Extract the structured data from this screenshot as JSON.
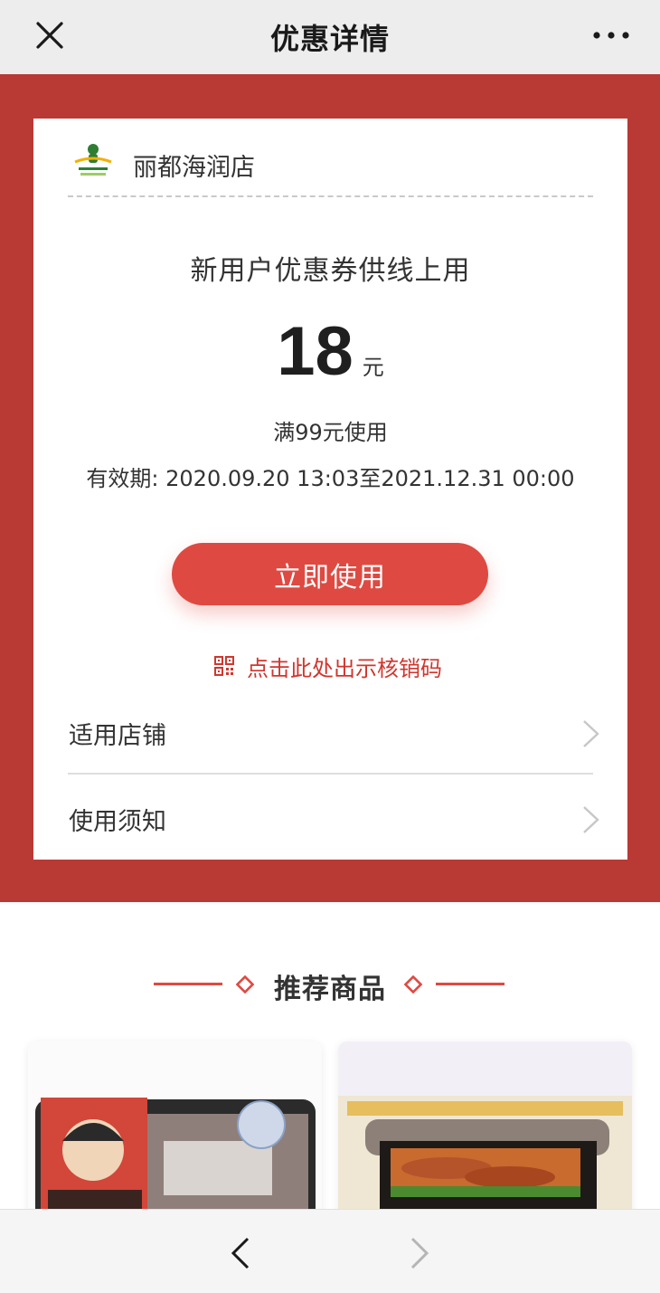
{
  "topbar": {
    "title": "优惠详情",
    "close_icon": "close-icon",
    "more_icon": "more-dots-icon"
  },
  "coupon": {
    "store_name": "丽都海润店",
    "name": "新用户优惠券供线上用",
    "amount": "18",
    "unit": "元",
    "condition": "满99元使用",
    "validity": "有效期: 2020.09.20 13:03至2021.12.31 00:00",
    "use_button": "立即使用",
    "qr_link": "点击此处出示核销码"
  },
  "menu": [
    {
      "label": "适用店铺"
    },
    {
      "label": "使用须知"
    }
  ],
  "recommend": {
    "title": "推荐商品"
  },
  "colors": {
    "accent": "#de4a42",
    "banner": "#b93a35",
    "link": "#d0362e"
  },
  "bottom_nav": {
    "back_icon": "chevron-left-icon",
    "forward_icon": "chevron-right-icon"
  }
}
